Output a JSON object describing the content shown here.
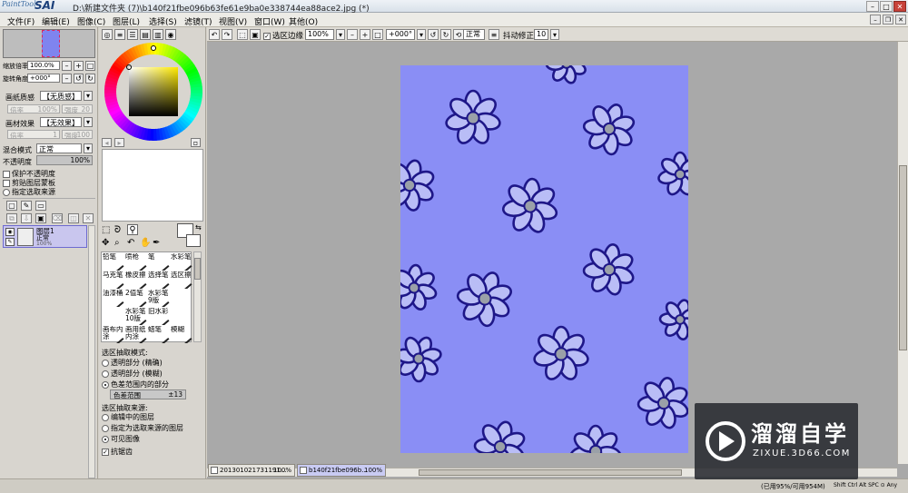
{
  "app": {
    "logo_small": "PaintTool",
    "logo_big": "SAI",
    "title": "D:\\新建文件夹 (7)\\b140f21fbe096b63fe61e9ba0e338744ea88ace2.jpg (*)"
  },
  "menu": [
    "文件(F)",
    "编辑(E)",
    "图像(C)",
    "图层(L)",
    "选择(S)",
    "滤镜(T)",
    "视图(V)",
    "窗口(W)",
    "其他(O)"
  ],
  "navigator": {
    "zoom_label": "缩放倍率",
    "zoom_value": "100.0%",
    "rotate_label": "旋转角度",
    "rotate_value": "+000°"
  },
  "paper": {
    "texture_label": "画纸质感",
    "texture_value": "【无质感】",
    "scale_label": "倍率",
    "scale_value": "100%",
    "strength_label": "强度",
    "strength_value": "20",
    "effect_label": "画材效果",
    "effect_value": "【无效果】",
    "effect_scale_label": "倍率",
    "effect_scale_value": "1",
    "effect_strength_label": "强度",
    "effect_strength_value": "100"
  },
  "layer_props": {
    "blend_label": "混合模式",
    "blend_value": "正常",
    "opacity_label": "不透明度",
    "opacity_value": "100%",
    "protect_opacity": "保护不透明度",
    "clip_group": "剪贴图层蒙板",
    "selection_source": "指定选取来源"
  },
  "layer": {
    "name": "图层1",
    "mode": "正常",
    "opacity": "100%"
  },
  "brushes": [
    "铅笔",
    "喷枪",
    "笔",
    "水彩笔",
    "马克笔",
    "橡皮擦",
    "选择笔",
    "选区擦",
    "油漆桶",
    "2值笔",
    "水彩笔9版",
    "",
    "",
    "水彩笔10版",
    "旧水彩",
    "",
    "画布内涂",
    "画用纸内涂",
    "蜡笔",
    "模糊"
  ],
  "tool_options": {
    "mode_title": "选区抽取模式:",
    "mode_options": [
      "透明部分 (精确)",
      "透明部分 (模糊)",
      "色差范围内的部分"
    ],
    "mode_selected": 2,
    "range_label": "色差范围",
    "range_value": "±13",
    "source_title": "选区抽取来源:",
    "source_options": [
      "编辑中的图层",
      "指定为选取来源的图层",
      "可见图像"
    ],
    "source_selected": 2,
    "antialias": "抗锯齿"
  },
  "toolbar": {
    "selection_edge": "选区边缘",
    "zoom": "100%",
    "angle": "+000°",
    "blend": "正常",
    "stabilizer_label": "抖动修正",
    "stabilizer_value": "10"
  },
  "tabs": [
    {
      "label": "201301021731191...",
      "pct": "100%"
    },
    {
      "label": "b140f21fbe096b...",
      "pct": "100%"
    }
  ],
  "status": {
    "memory": "(已用95%/可用954M)",
    "keys": "Shift Ctrl Alt SPC ⊙ Any"
  },
  "watermark": {
    "cn": "溜溜自学",
    "en": "ZIXUE.3D66.COM"
  },
  "colors": {
    "canvas": "#8a8ef5",
    "flower_outline": "#1e1788",
    "petal": "#b9bdf6",
    "center": "#9aa0a8"
  }
}
